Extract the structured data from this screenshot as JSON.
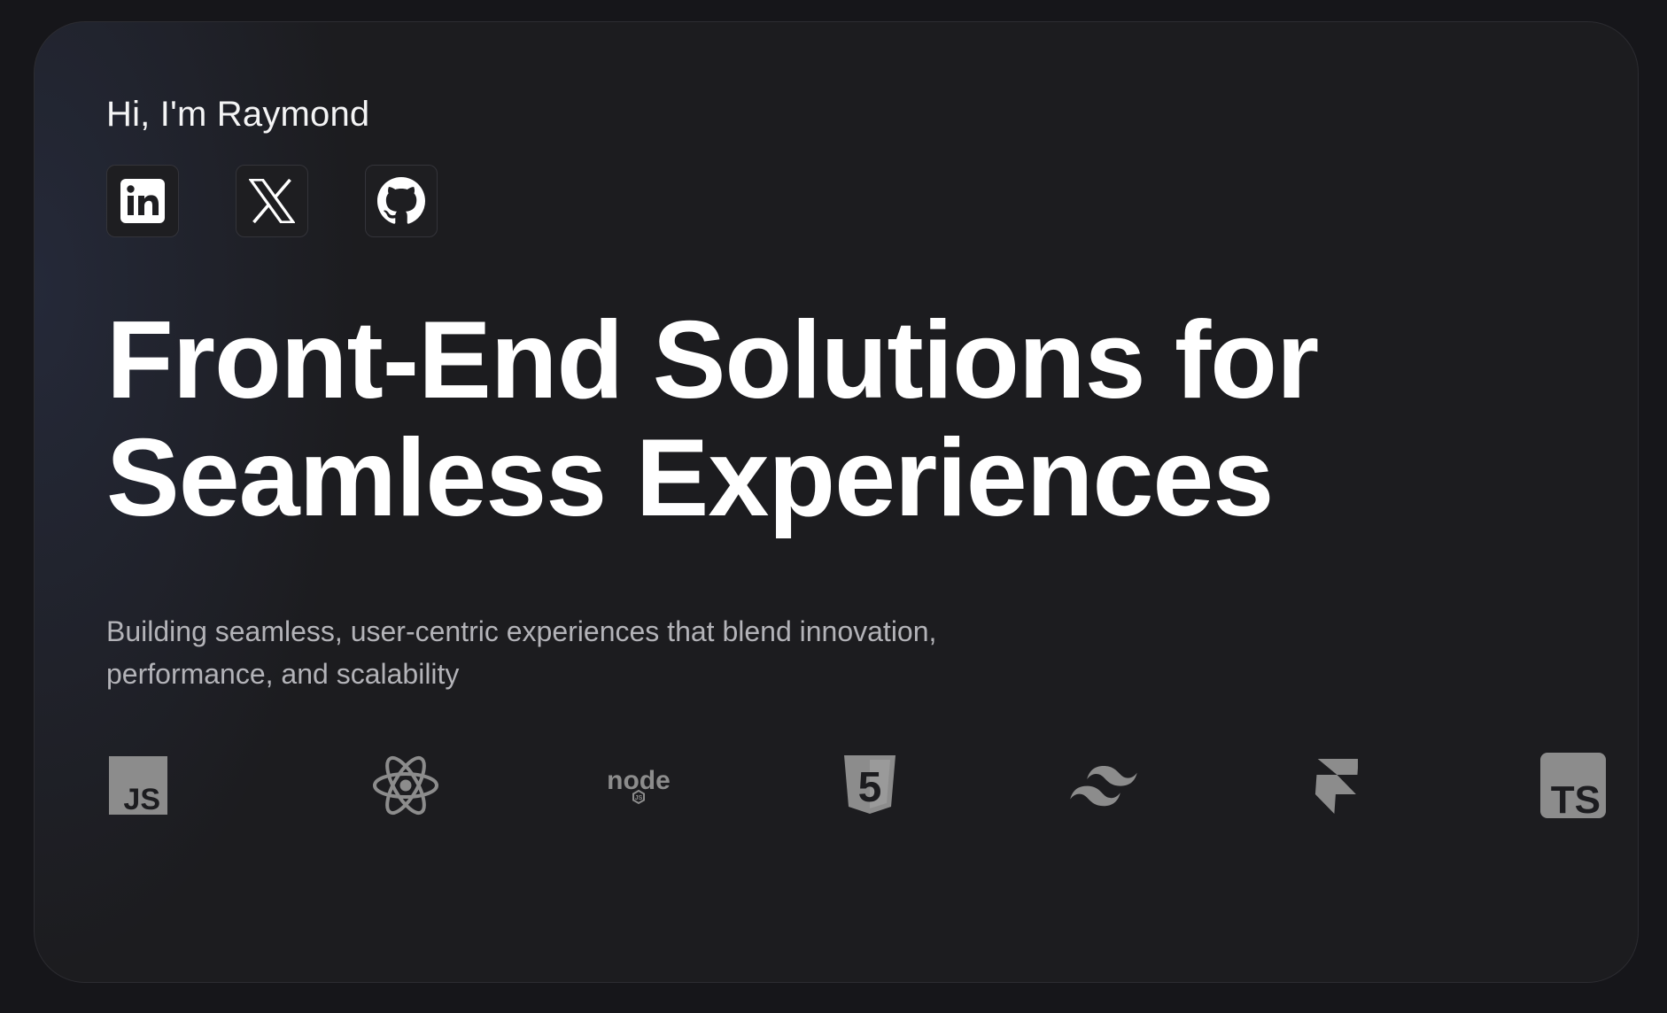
{
  "hero": {
    "greeting": "Hi, I'm Raymond",
    "headline_line1": "Front-End Solutions for",
    "headline_line2": "Seamless Experiences",
    "subtitle_line1": "Building seamless, user-centric experiences that blend innovation,",
    "subtitle_line2": "performance, and scalability"
  },
  "socials": [
    {
      "icon": "linkedin-icon"
    },
    {
      "icon": "x-icon"
    },
    {
      "icon": "github-icon"
    }
  ],
  "tech_stack": [
    {
      "icon": "javascript-icon",
      "label": "JS"
    },
    {
      "icon": "react-icon"
    },
    {
      "icon": "nodejs-icon",
      "label": "node"
    },
    {
      "icon": "html5-icon",
      "label": "5"
    },
    {
      "icon": "tailwind-icon"
    },
    {
      "icon": "framer-icon"
    },
    {
      "icon": "typescript-icon",
      "label": "TS"
    }
  ],
  "colors": {
    "page_background": "#16161a",
    "card_background": "#1c1c1f",
    "text_primary": "#ffffff",
    "text_secondary": "#b3b3b8",
    "icon_gray": "#8c8c8c"
  }
}
